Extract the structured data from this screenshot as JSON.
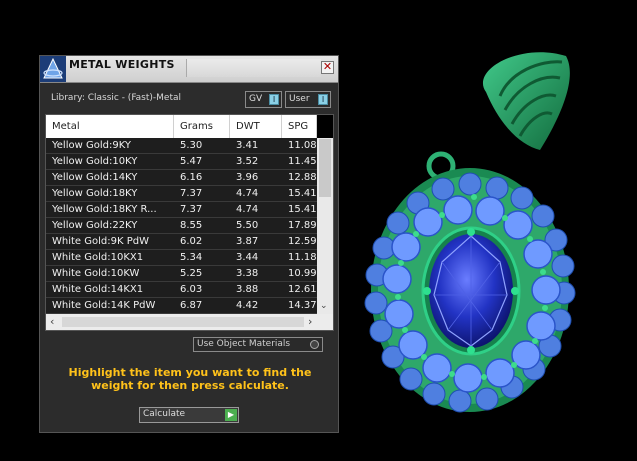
{
  "panel": {
    "title": "METAL WEIGHTS",
    "library_label": "Library: Classic - (Fast)-Metal",
    "gv_label": "GV",
    "user_label": "User",
    "toggle_glyph": "I",
    "close_glyph": "✕"
  },
  "table": {
    "columns": [
      "Metal",
      "Grams",
      "DWT",
      "SPG"
    ],
    "rows": [
      [
        "Yellow Gold:9KY",
        "5.30",
        "3.41",
        "11.08"
      ],
      [
        "Yellow Gold:10KY",
        "5.47",
        "3.52",
        "11.45"
      ],
      [
        "Yellow Gold:14KY",
        "6.16",
        "3.96",
        "12.88"
      ],
      [
        "Yellow Gold:18KY",
        "7.37",
        "4.74",
        "15.41"
      ],
      [
        "Yellow Gold:18KY R...",
        "7.37",
        "4.74",
        "15.41"
      ],
      [
        "Yellow Gold:22KY",
        "8.55",
        "5.50",
        "17.89"
      ],
      [
        "White Gold:9K PdW",
        "6.02",
        "3.87",
        "12.59"
      ],
      [
        "White Gold:10KX1",
        "5.34",
        "3.44",
        "11.18"
      ],
      [
        "White Gold:10KW",
        "5.25",
        "3.38",
        "10.99"
      ],
      [
        "White Gold:14KX1",
        "6.03",
        "3.88",
        "12.61"
      ],
      [
        "White Gold:14K PdW",
        "6.87",
        "4.42",
        "14.37"
      ]
    ],
    "scroll_down_glyph": "⌄",
    "scroll_left_glyph": "‹",
    "scroll_right_glyph": "›"
  },
  "controls": {
    "use_object_materials_label": "Use Object Materials",
    "hint_text": "Highlight the item you want to find the weight for then press calculate.",
    "calculate_label": "Calculate",
    "calculate_glyph": "▶"
  },
  "colors": {
    "hint": "#ffc21a",
    "metal_green": "#1f9a5c",
    "sapphire": "#1d2fb8",
    "small_stones": "#4f7fe0"
  },
  "icons": [
    "app-logo-icon",
    "close-icon",
    "toggle-icon",
    "radio-icon",
    "play-icon",
    "chevron-down-icon",
    "chevron-left-icon",
    "chevron-right-icon"
  ]
}
